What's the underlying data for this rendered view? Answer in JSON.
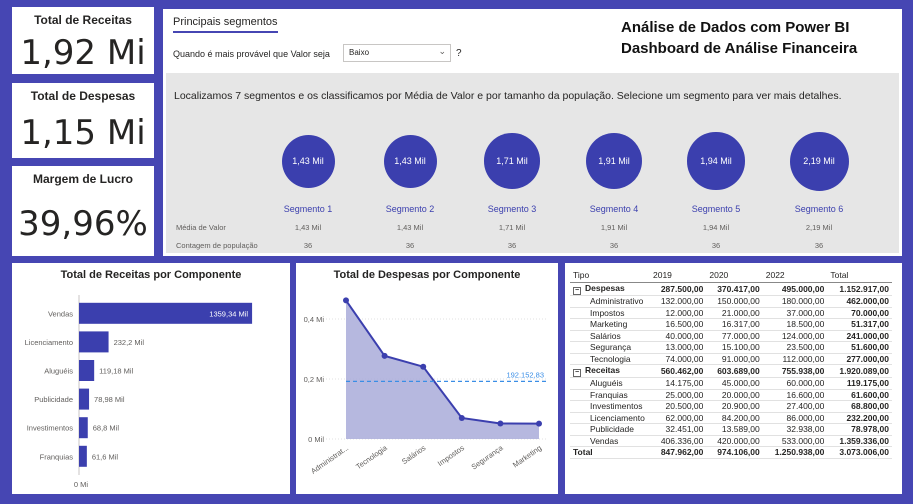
{
  "kpis": {
    "receitas": {
      "title": "Total de Receitas",
      "value": "1,92 Mi"
    },
    "despesas": {
      "title": "Total de Despesas",
      "value": "1,15 Mi"
    },
    "margem": {
      "title": "Margem de Lucro",
      "value": "39,96%"
    }
  },
  "segments": {
    "tab_label": "Principais segmentos",
    "question": "Quando é mais provável que Valor seja",
    "select_value": "Baixo",
    "help": "?",
    "heading_line1": "Análise de Dados com Power BI",
    "heading_line2": "Dashboard de Análise Financeira",
    "description": "Localizamos 7 segmentos e os classificamos por Média de Valor e por tamanho da população. Selecione um segmento para ver mais detalhes.",
    "row_label_media": "Média de Valor",
    "row_label_contagem": "Contagem de população",
    "items": [
      {
        "name": "Segmento 1",
        "bubble": "1,43 Mil",
        "media": "1,43 Mil",
        "contagem": "36"
      },
      {
        "name": "Segmento 2",
        "bubble": "1,43 Mil",
        "media": "1,43 Mil",
        "contagem": "36"
      },
      {
        "name": "Segmento 3",
        "bubble": "1,71 Mil",
        "media": "1,71 Mil",
        "contagem": "36"
      },
      {
        "name": "Segmento 4",
        "bubble": "1,91 Mil",
        "media": "1,91 Mil",
        "contagem": "36"
      },
      {
        "name": "Segmento 5",
        "bubble": "1,94 Mil",
        "media": "1,94 Mil",
        "contagem": "36"
      },
      {
        "name": "Segmento 6",
        "bubble": "2,19 Mil",
        "media": "2,19 Mil",
        "contagem": "36"
      }
    ]
  },
  "colors": {
    "accent": "#4646b3",
    "bar": "#3b3fae",
    "area": "#a9abd9",
    "line": "#3b3fae",
    "avg_line": "#3a8ee6"
  },
  "chart_data": [
    {
      "type": "bar",
      "title": "Total de Receitas por Componente",
      "categories": [
        "Vendas",
        "Licenciamento",
        "Aluguéis",
        "Publicidade",
        "Investimentos",
        "Franquias"
      ],
      "values": [
        1359.34,
        232.2,
        119.18,
        78.98,
        68.8,
        61.6
      ],
      "data_labels": [
        "1359,34 Mil",
        "232,2 Mil",
        "119,18 Mil",
        "78,98 Mil",
        "68,8 Mil",
        "61,6 Mil"
      ],
      "x_tick_labels": [
        "0 Mi"
      ],
      "xlim": [
        0,
        1500
      ]
    },
    {
      "type": "area",
      "title": "Total de Despesas por Componente",
      "categories": [
        "Administrat...",
        "Tecnologia",
        "Salários",
        "Impostos",
        "Segurança",
        "Marketing"
      ],
      "values": [
        462.0,
        277.0,
        241.0,
        70.0,
        51.6,
        51.317
      ],
      "y_tick_labels": [
        "0 Mil",
        "0,2 Mi",
        "0,4 Mi"
      ],
      "y_ticks": [
        0,
        200,
        400
      ],
      "ylim": [
        0,
        500
      ],
      "reference_line": {
        "value": 192.15283,
        "label": "192.152,83"
      }
    }
  ],
  "table": {
    "headers": [
      "Tipo",
      "2019",
      "2020",
      "2022",
      "Total"
    ],
    "groups": [
      {
        "name": "Despesas",
        "values": [
          "287.500,00",
          "370.417,00",
          "495.000,00",
          "1.152.917,00"
        ],
        "rows": [
          {
            "name": "Administrativo",
            "values": [
              "132.000,00",
              "150.000,00",
              "180.000,00",
              "462.000,00"
            ]
          },
          {
            "name": "Impostos",
            "values": [
              "12.000,00",
              "21.000,00",
              "37.000,00",
              "70.000,00"
            ]
          },
          {
            "name": "Marketing",
            "values": [
              "16.500,00",
              "16.317,00",
              "18.500,00",
              "51.317,00"
            ]
          },
          {
            "name": "Salários",
            "values": [
              "40.000,00",
              "77.000,00",
              "124.000,00",
              "241.000,00"
            ]
          },
          {
            "name": "Segurança",
            "values": [
              "13.000,00",
              "15.100,00",
              "23.500,00",
              "51.600,00"
            ]
          },
          {
            "name": "Tecnologia",
            "values": [
              "74.000,00",
              "91.000,00",
              "112.000,00",
              "277.000,00"
            ]
          }
        ]
      },
      {
        "name": "Receitas",
        "values": [
          "560.462,00",
          "603.689,00",
          "755.938,00",
          "1.920.089,00"
        ],
        "rows": [
          {
            "name": "Aluguéis",
            "values": [
              "14.175,00",
              "45.000,00",
              "60.000,00",
              "119.175,00"
            ]
          },
          {
            "name": "Franquias",
            "values": [
              "25.000,00",
              "20.000,00",
              "16.600,00",
              "61.600,00"
            ]
          },
          {
            "name": "Investimentos",
            "values": [
              "20.500,00",
              "20.900,00",
              "27.400,00",
              "68.800,00"
            ]
          },
          {
            "name": "Licenciamento",
            "values": [
              "62.000,00",
              "84.200,00",
              "86.000,00",
              "232.200,00"
            ]
          },
          {
            "name": "Publicidade",
            "values": [
              "32.451,00",
              "13.589,00",
              "32.938,00",
              "78.978,00"
            ]
          },
          {
            "name": "Vendas",
            "values": [
              "406.336,00",
              "420.000,00",
              "533.000,00",
              "1.359.336,00"
            ]
          }
        ]
      }
    ],
    "total": {
      "name": "Total",
      "values": [
        "847.962,00",
        "974.106,00",
        "1.250.938,00",
        "3.073.006,00"
      ]
    }
  }
}
